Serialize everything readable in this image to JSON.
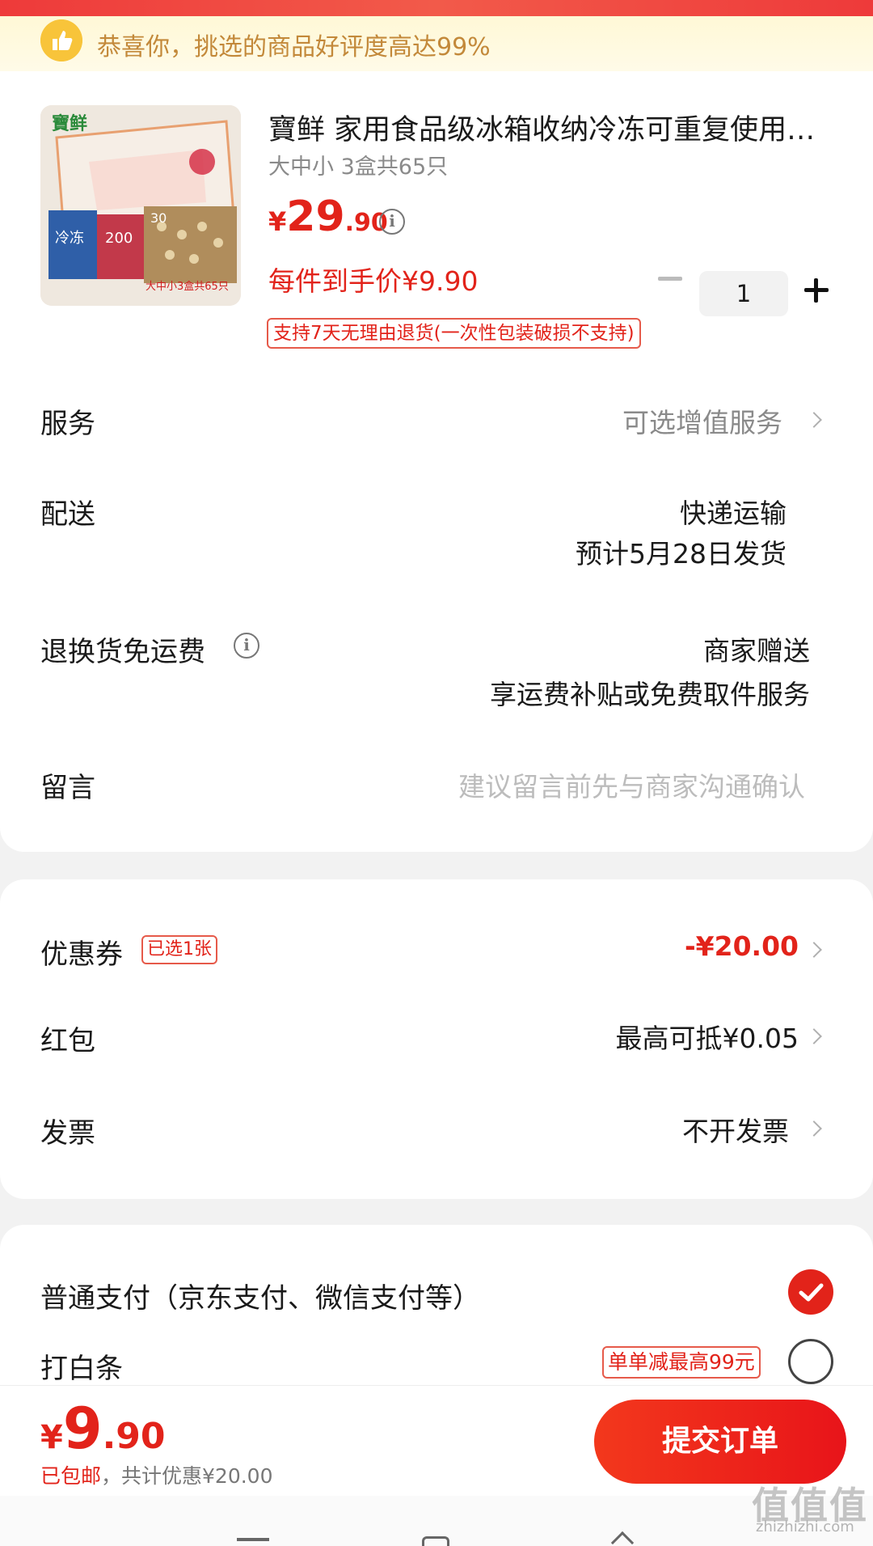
{
  "banner": {
    "text": "恭喜你，挑选的商品好评度高达99%",
    "icon": "thumbs-up-icon"
  },
  "product": {
    "title": "寶鲜 家用食品级冰箱收纳冷冻可重复使用…",
    "spec": "大中小 3盒共65只",
    "price_yen": "¥",
    "price_int": "29",
    "price_dec": ".90",
    "per_item": "每件到手价¥9.90",
    "return_policy": "支持7天无理由退货(一次性包装破损不支持)",
    "quantity": "1",
    "image_texts": [
      "寶鲜",
      "冷冻",
      "200",
      "30",
      "大中小3盒共65只"
    ]
  },
  "rows": {
    "service": {
      "label": "服务",
      "value": "可选增值服务"
    },
    "delivery": {
      "label": "配送",
      "value_line1": "快递运输",
      "value_line2": "预计5月28日发货"
    },
    "return_shipping": {
      "label": "退换货免运费",
      "value_line1": "商家赠送",
      "value_line2": "享运费补贴或免费取件服务"
    },
    "message": {
      "label": "留言",
      "placeholder": "建议留言前先与商家沟通确认"
    }
  },
  "discounts": {
    "coupon": {
      "label": "优惠券",
      "tag": "已选1张",
      "value": "-¥20.00"
    },
    "red_packet": {
      "label": "红包",
      "value": "最高可抵¥0.05"
    },
    "invoice": {
      "label": "发票",
      "value": "不开发票"
    }
  },
  "payment": {
    "normal": {
      "label": "普通支付（京东支付、微信支付等）",
      "selected": true
    },
    "baitiao": {
      "label": "打白条",
      "tag": "单单减最高99元",
      "selected": false
    }
  },
  "bottom": {
    "total_yen": "¥",
    "total_int": "9",
    "total_dec": ".90",
    "free_shipping": "已包邮",
    "savings": "，共计优惠¥20.00",
    "submit_label": "提交订单"
  },
  "watermark": {
    "line1": "值值值",
    "line2": "zhizhizhi.com"
  },
  "colors": {
    "accent": "#e2231a",
    "banner_text": "#c3893a",
    "banner_bg": "#fff8d6"
  }
}
